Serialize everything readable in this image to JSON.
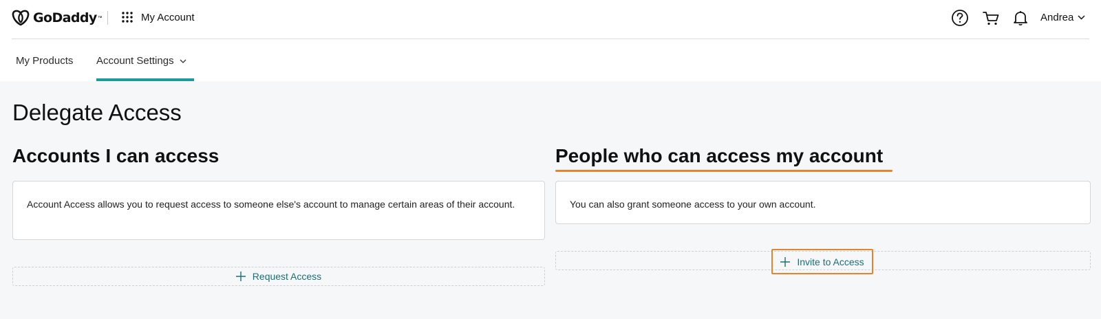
{
  "header": {
    "logo_text": "GoDaddy",
    "logo_tm": "™",
    "app_title": "My Account",
    "icons": [
      "help-icon",
      "cart-icon",
      "bell-icon",
      "apps-grid-icon",
      "chevron-down-icon"
    ],
    "user_name": "Andrea"
  },
  "nav": {
    "items": [
      {
        "label": "My Products"
      },
      {
        "label": "Account Settings"
      }
    ]
  },
  "page": {
    "title": "Delegate Access"
  },
  "left_section": {
    "title": "Accounts I can access",
    "description": "Account Access allows you to request access to someone else's account to manage certain areas of their account.",
    "button_label": "Request Access"
  },
  "right_section": {
    "title": "People who can access my account",
    "description": "You can also grant someone access to your own account.",
    "button_label": "Invite to Access"
  },
  "colors": {
    "accent_teal": "#1f9a9a",
    "button_text": "#1b6e74",
    "highlight_orange": "#e8832b",
    "background": "#f5f7f8"
  }
}
